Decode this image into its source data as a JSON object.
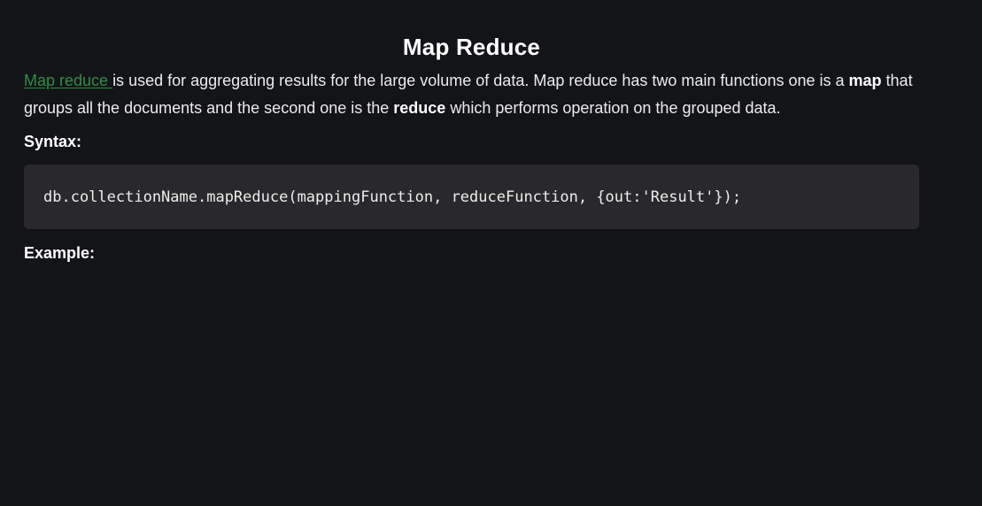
{
  "article": {
    "title": "Map Reduce",
    "intro": {
      "link_text": "Map reduce ",
      "part1": "is used for aggregating results for the large volume of data. Map reduce has two main functions one is a ",
      "bold1": "map",
      "part2": " that groups all the documents and the second one is the ",
      "bold2": "reduce",
      "part3": " which performs operation on the grouped data."
    },
    "syntax": {
      "heading": "Syntax:",
      "code": "db.collectionName.mapReduce(mappingFunction, reduceFunction, {out:'Result'});"
    },
    "example": {
      "heading": "Example:"
    }
  },
  "colors": {
    "background": "#131417",
    "link": "#2f8d46",
    "code_background": "#29292c",
    "text": "#ececec"
  }
}
